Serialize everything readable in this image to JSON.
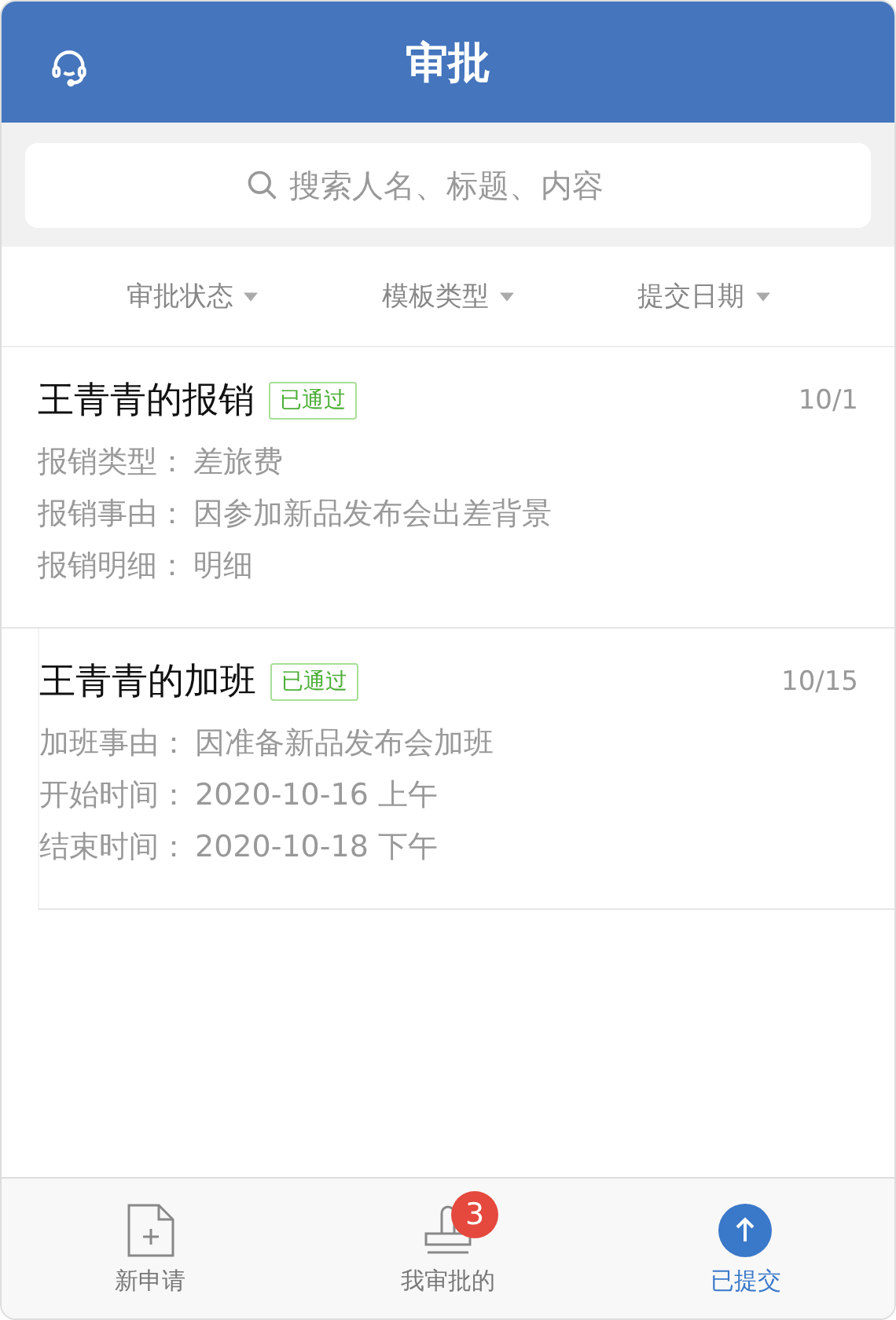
{
  "header": {
    "title": "审批"
  },
  "search": {
    "placeholder": "搜索人名、标题、内容"
  },
  "filters": [
    {
      "label": "审批状态"
    },
    {
      "label": "模板类型"
    },
    {
      "label": "提交日期"
    }
  ],
  "items": [
    {
      "title": "王青青的报销",
      "status": "已通过",
      "date": "10/1",
      "fields": [
        {
          "label": "报销类型：",
          "value": "差旅费"
        },
        {
          "label": "报销事由：",
          "value": "因参加新品发布会出差背景"
        },
        {
          "label": "报销明细：",
          "value": "明细"
        }
      ]
    },
    {
      "title": "王青青的加班",
      "status": "已通过",
      "date": "10/15",
      "fields": [
        {
          "label": "加班事由：",
          "value": "因准备新品发布会加班"
        },
        {
          "label": "开始时间：",
          "value": "2020-10-16 上午"
        },
        {
          "label": "结束时间：",
          "value": "2020-10-18 下午"
        }
      ]
    }
  ],
  "tabs": [
    {
      "kind": "new",
      "label": "新申请",
      "selected": false
    },
    {
      "kind": "stamp",
      "label": "我审批的",
      "selected": false,
      "badge": "3"
    },
    {
      "kind": "submitted",
      "label": "已提交",
      "selected": true
    }
  ]
}
